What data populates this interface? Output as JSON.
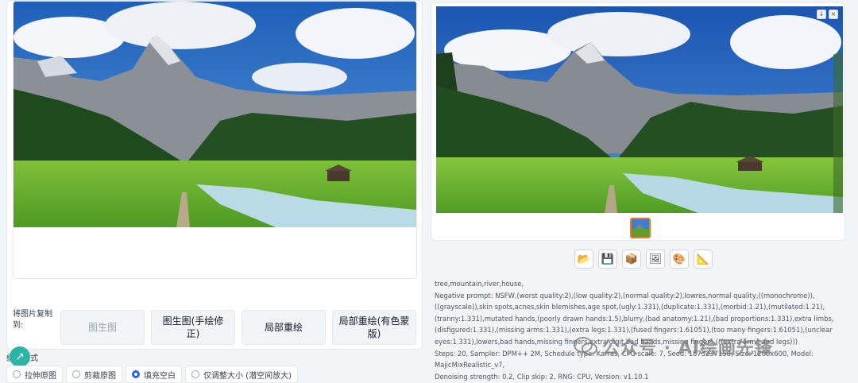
{
  "left": {
    "copy_label": "将图片复制到:",
    "buttons": [
      "图生图",
      "图生图(手绘修正)",
      "局部重绘",
      "局部重绘(有色蒙版)"
    ],
    "resize_mode_label": "缩放模式",
    "resize_options": [
      {
        "label": "拉伸原图",
        "selected": false
      },
      {
        "label": "剪裁原图",
        "selected": false
      },
      {
        "label": "填充空白",
        "selected": true
      },
      {
        "label": "仅调整大小 (潜空间放大)",
        "selected": false
      }
    ]
  },
  "right": {
    "tool_icons": [
      "folder-icon",
      "save-icon",
      "zip-icon",
      "image-icon",
      "palette-icon",
      "ruler-icon"
    ],
    "tool_glyphs": [
      "📂",
      "💾",
      "📦",
      "🖼",
      "🎨",
      "📐"
    ],
    "info": {
      "prompt": "tree,mountain,river,house,",
      "negative": "Negative prompt: NSFW,(worst quality:2),(low quality:2),(normal quality:2),lowres,normal quality,((monochrome)),((grayscale)),skin spots,acnes,skin blemishes,age spot,(ugly:1.331),(duplicate:1.331),(morbid:1.21),(mutilated:1.21),(tranny:1.331),mutated hands,(poorly drawn hands:1.5),blurry,(bad anatomy:1.21),(bad proportions:1.331),extra limbs,(disfigured:1.331),(missing arms:1.331),(extra legs:1.331),(fused fingers:1.61051),(too many fingers:1.61051),(unclear eyes:1.331),lowers,bad hands,missing fingers,extra digit,bad hands,missing fingers,(((extra arms and legs)))",
      "params": "Steps: 20, Sampler: DPM++ 2M, Schedule type: Karras, CFG scale: 7, Seed: 1873237158, Size: 1200x600, Model: MajicMixRealistic_v7,",
      "params2": "Denoising strength: 0.2, Clip skip: 2, RNG: CPU, Version: v1.10.1"
    }
  },
  "watermark": "公众号 · AI绘画先锋"
}
